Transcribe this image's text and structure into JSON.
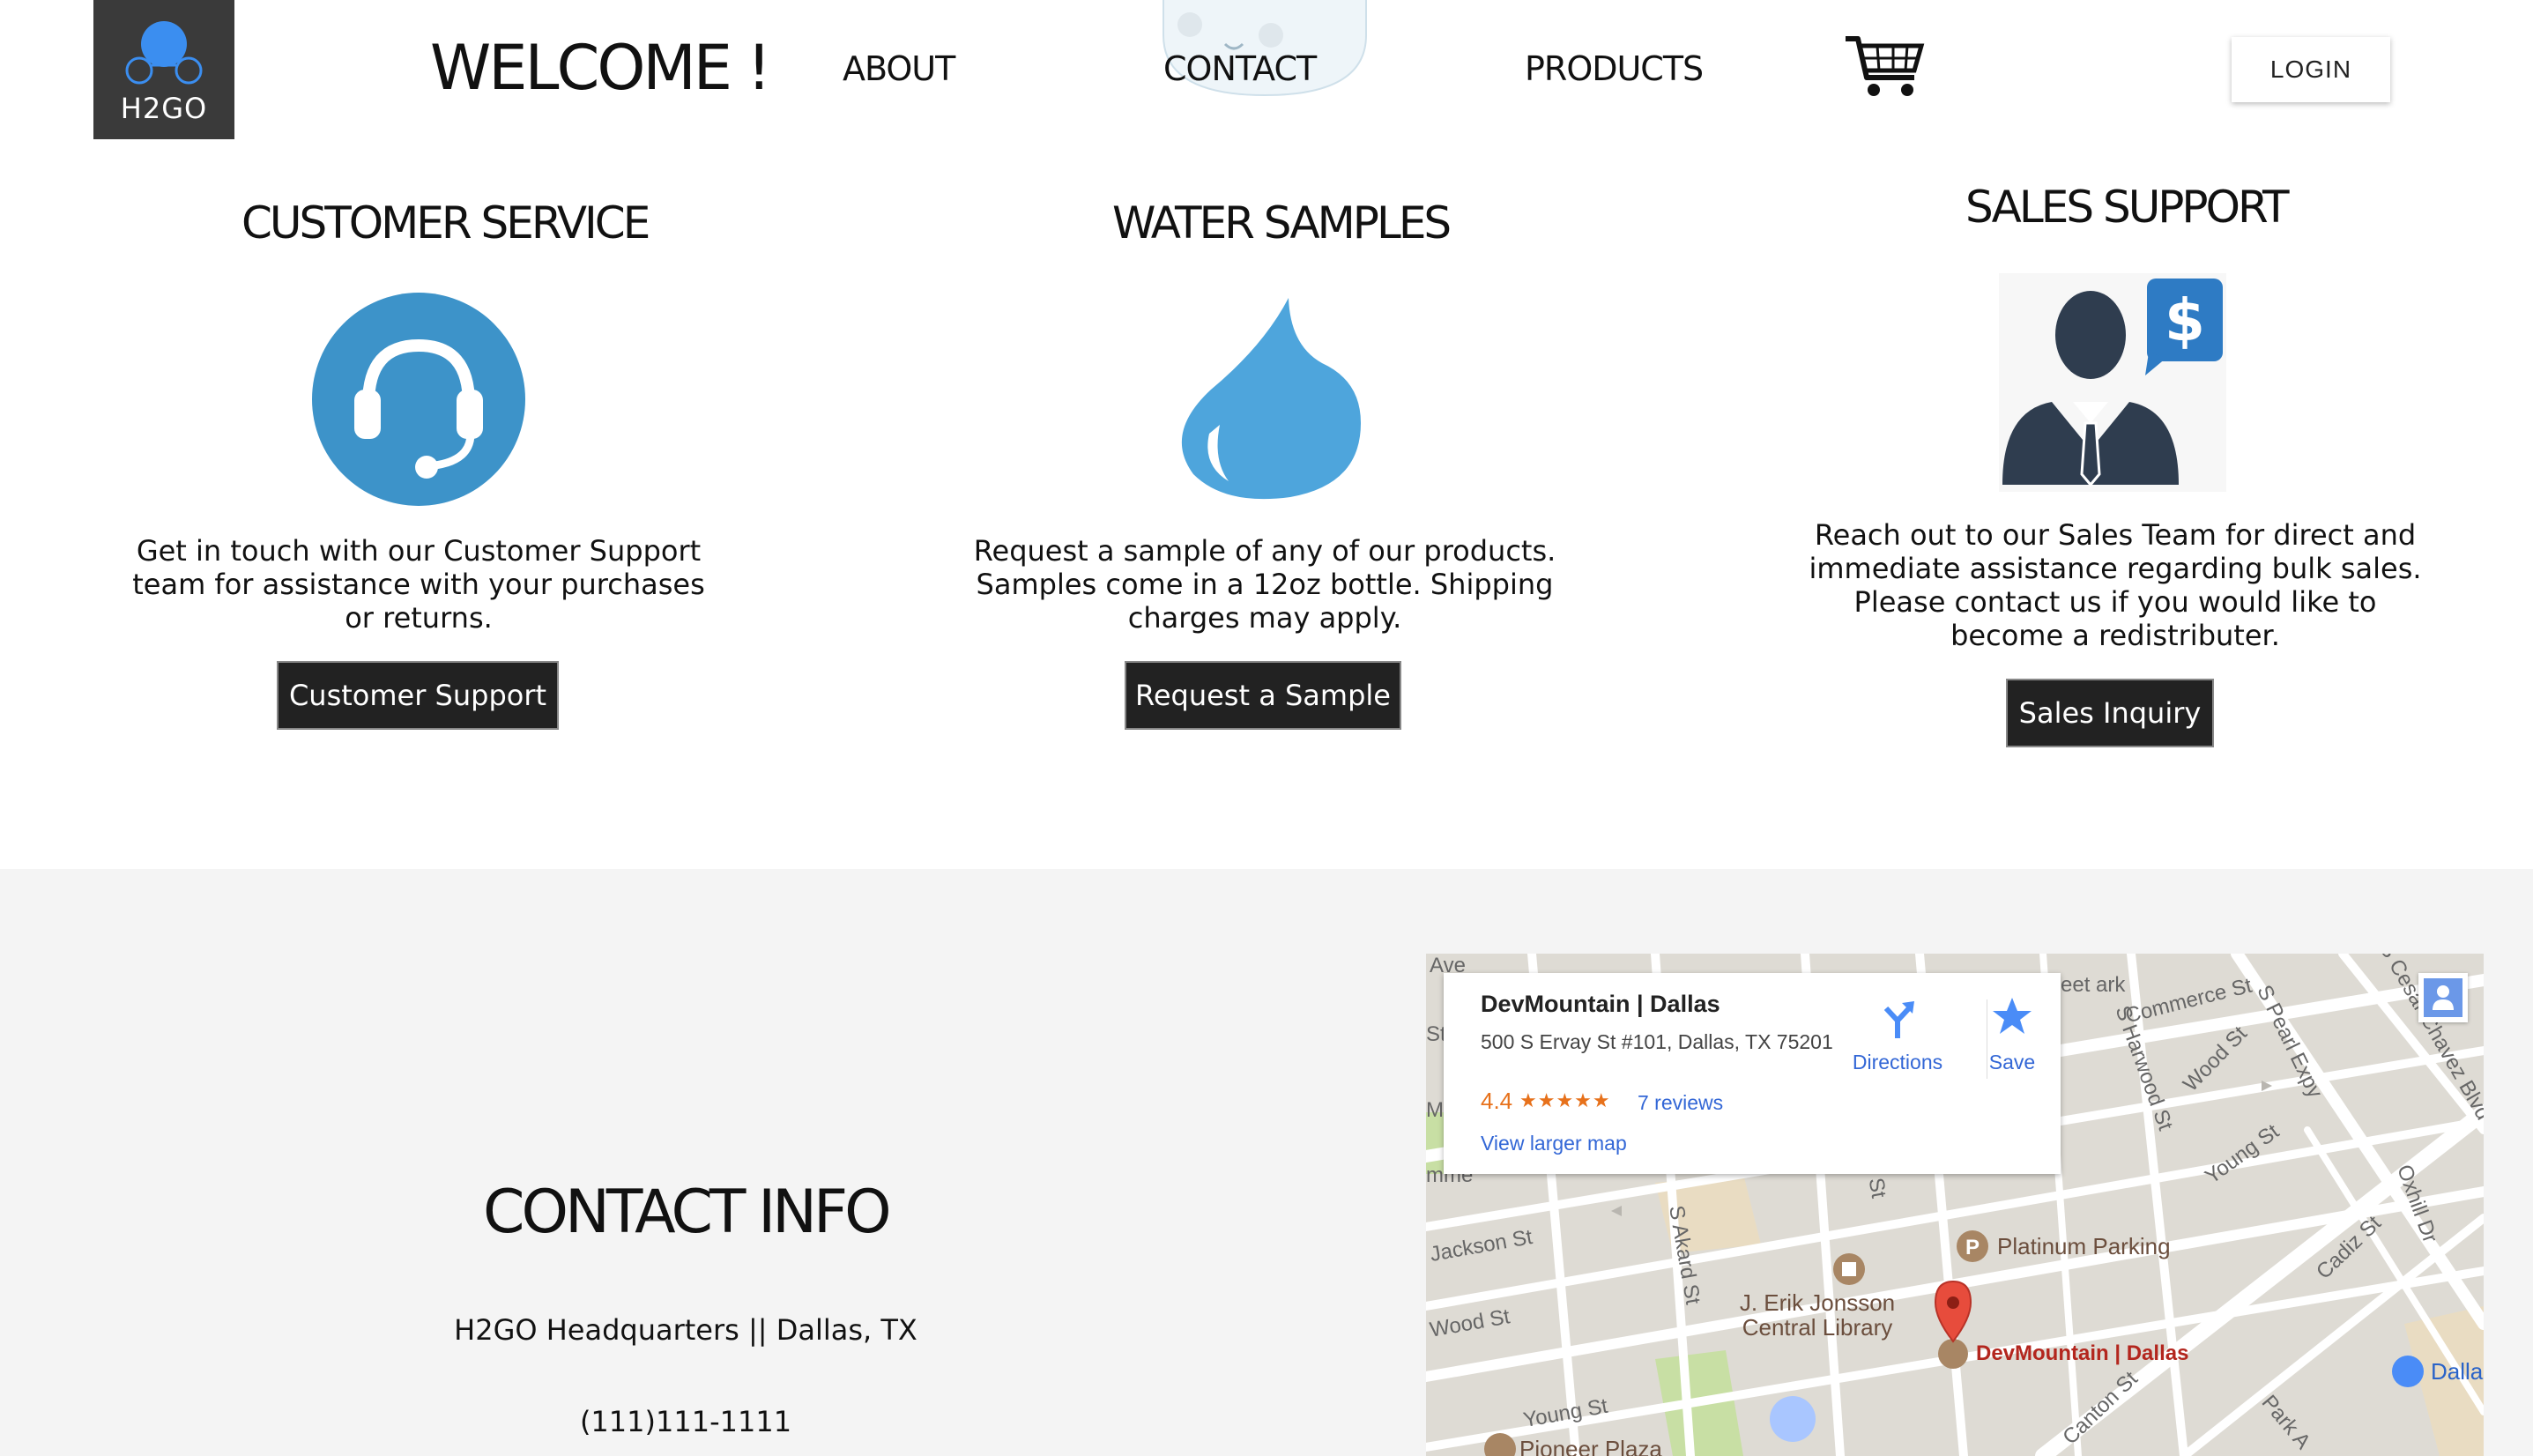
{
  "nav": {
    "logo_text": "H2GO",
    "welcome": "WELCOME !",
    "about": "ABOUT",
    "contact": "CONTACT",
    "products": "PRODUCTS",
    "login": "LOGIN",
    "cart_icon": "shopping-cart-icon"
  },
  "services": [
    {
      "title": "CUSTOMER SERVICE",
      "icon": "headset-icon",
      "description": "Get in touch with our Customer Support team for assistance with your purchases or returns.",
      "button": "Customer Support"
    },
    {
      "title": "WATER SAMPLES",
      "icon": "water-drop-icon",
      "description": "Request a sample of any of our products. Samples come in a 12oz bottle. Shipping charges may apply.",
      "button": "Request a Sample"
    },
    {
      "title": "SALES SUPPORT",
      "icon": "salesman-icon",
      "description": "Reach out to our Sales Team for direct and immediate assistance regarding bulk sales. Please contact us if you would like to become a redistributer.",
      "button": "Sales Inquiry"
    }
  ],
  "contact": {
    "title": "CONTACT INFO",
    "headquarters": "H2GO Headquarters || Dallas, TX",
    "phone": "(111)111-1111"
  },
  "map": {
    "place_name": "DevMountain | Dallas",
    "address": "500 S Ervay St #101, Dallas, TX 75201",
    "rating": "4.4",
    "stars": "★★★★★",
    "reviews": "7 reviews",
    "view_larger": "View larger map",
    "directions": "Directions",
    "save": "Save",
    "streets": {
      "commerce": "Commerce St",
      "s_pearl": "S Pearl Expy",
      "s_harwood": "S Harwood St",
      "wood_st_right": "Wood St",
      "young_st_right": "Young St",
      "cesar_chavez": "S Cesar Chavez Blvd",
      "jackson": "Jackson St",
      "wood_st_left": "Wood St",
      "s_akard": "S Akard St",
      "young_st_left": "Young St",
      "cadiz": "Cadiz St",
      "canton": "Canton St",
      "park": "Park A",
      "oxhill": "Oxhill Dr",
      "ave": "Ave",
      "st_left": "St",
      "st_mid": "St",
      "park_fragment": "eet ark",
      "ma_fragment": "Ma",
      "mme_fragment": "mme"
    },
    "pois": {
      "platinum": "Platinum Parking",
      "library": "J. Erik Jonsson Central Library",
      "devmountain": "DevMountain | Dallas",
      "pioneer": "Pioneer Plaza",
      "dallas": "Dalla"
    },
    "colors": {
      "road": "#ffffff",
      "block": "#dedbd4",
      "park": "#c8dfa4",
      "link": "#3367d6",
      "pin": "#e74c3c"
    }
  }
}
